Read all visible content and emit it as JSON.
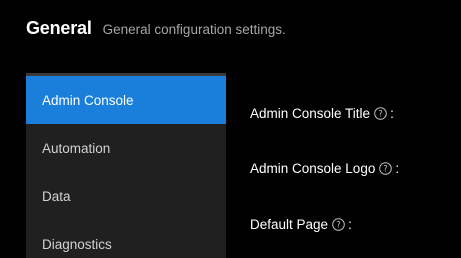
{
  "header": {
    "title": "General",
    "subtitle": "General configuration settings."
  },
  "sidebar": {
    "items": [
      {
        "label": "Admin Console",
        "active": true
      },
      {
        "label": "Automation",
        "active": false
      },
      {
        "label": "Data",
        "active": false
      },
      {
        "label": "Diagnostics",
        "active": false
      }
    ]
  },
  "settings": {
    "fields": [
      {
        "label": "Admin Console Title",
        "icon": "help-icon",
        "suffix": ":"
      },
      {
        "label": "Admin Console Logo",
        "icon": "help-icon",
        "suffix": ":"
      },
      {
        "label": "Default Page",
        "icon": "help-icon",
        "suffix": ":"
      }
    ]
  },
  "colors": {
    "background": "#000000",
    "sidebar_bg": "#202020",
    "active_item": "#1a7fdb",
    "subtitle_text": "#a6a6a6"
  }
}
